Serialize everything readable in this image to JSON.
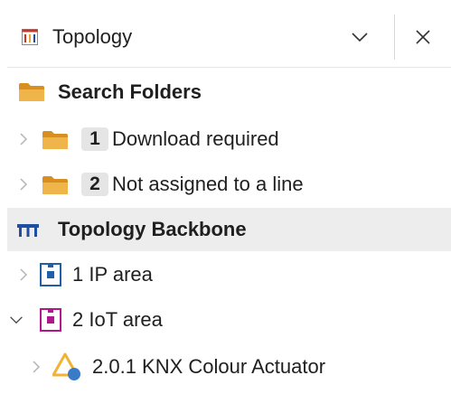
{
  "header": {
    "title": "Topology",
    "icon": "topology-panel-icon",
    "dropdown_icon": "chevron-down-icon",
    "close_icon": "close-icon"
  },
  "tree": {
    "search_folders": {
      "label": "Search Folders",
      "icon": "folder-icon",
      "items": [
        {
          "badge": "1",
          "label": "Download required"
        },
        {
          "badge": "2",
          "label": "Not assigned to a line"
        }
      ]
    },
    "backbone": {
      "label": "Topology Backbone",
      "icon": "backbone-icon",
      "areas": [
        {
          "label": "1 IP area",
          "expanded": false,
          "color": "#1f5fa8"
        },
        {
          "label": "2 IoT area",
          "expanded": true,
          "color": "#b0178f",
          "devices": [
            {
              "label": "2.0.1 KNX Colour Actuator",
              "icon": "device-warning-icon"
            }
          ]
        }
      ]
    }
  },
  "colors": {
    "folder": "#e3a83c",
    "backbone": "#1f4ea3",
    "selected_row": "#ededed",
    "badge_bg": "#e5e5e5",
    "warning": "#f2b233",
    "device_blue": "#3a7bc8"
  }
}
